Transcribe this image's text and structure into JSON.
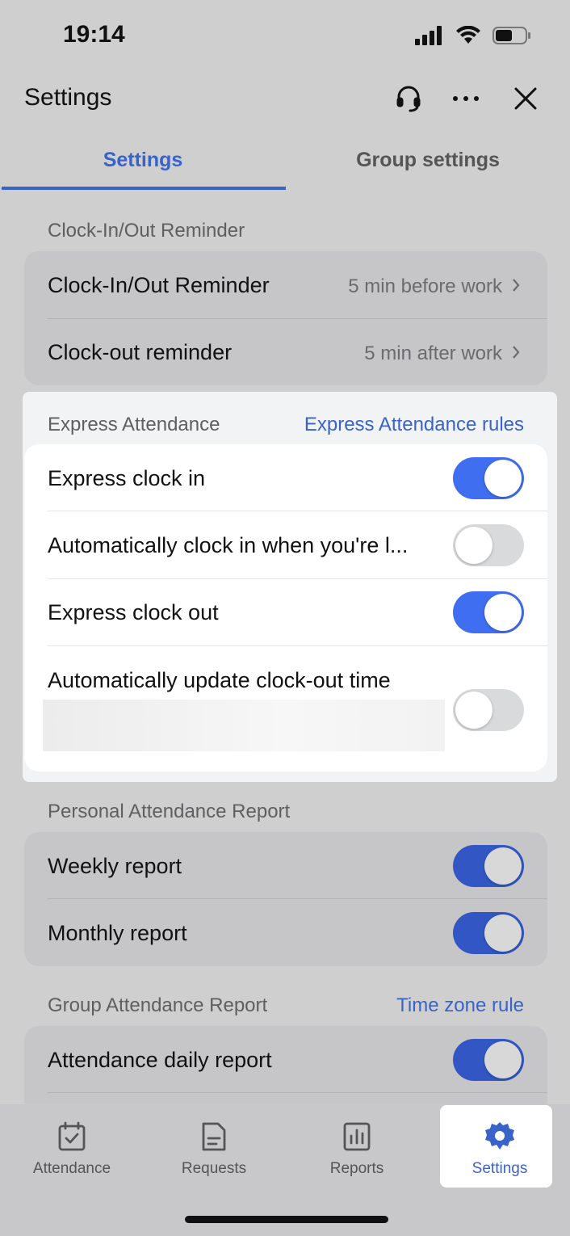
{
  "status_bar": {
    "time": "19:14"
  },
  "header": {
    "title": "Settings"
  },
  "tabs": [
    {
      "label": "Settings",
      "active": true
    },
    {
      "label": "Group settings",
      "active": false
    }
  ],
  "reminder_section": {
    "label": "Clock-In/Out Reminder",
    "rows": [
      {
        "label": "Clock-In/Out Reminder",
        "value": "5 min before work"
      },
      {
        "label": "Clock-out reminder",
        "value": "5 min after work"
      }
    ]
  },
  "express_section": {
    "label": "Express Attendance",
    "link": "Express Attendance rules",
    "rows": [
      {
        "label": "Express clock in",
        "on": true
      },
      {
        "label": "Automatically clock in when you're l...",
        "on": false
      },
      {
        "label": "Express clock out",
        "on": true
      },
      {
        "label": "Automatically update clock-out time",
        "on": false
      }
    ]
  },
  "personal_section": {
    "label": "Personal Attendance Report",
    "rows": [
      {
        "label": "Weekly report",
        "on": true
      },
      {
        "label": "Monthly report",
        "on": true
      }
    ]
  },
  "group_section": {
    "label": "Group Attendance Report",
    "link": "Time zone rule",
    "rows": [
      {
        "label": "Attendance daily report",
        "on": true
      }
    ]
  },
  "bottom_nav": [
    {
      "label": "Attendance",
      "icon": "calendar-check-icon"
    },
    {
      "label": "Requests",
      "icon": "document-icon"
    },
    {
      "label": "Reports",
      "icon": "bar-chart-icon"
    },
    {
      "label": "Settings",
      "icon": "gear-icon",
      "active": true
    }
  ],
  "colors": {
    "accent": "#3f6ef0",
    "tab_active": "#3a63c9"
  }
}
